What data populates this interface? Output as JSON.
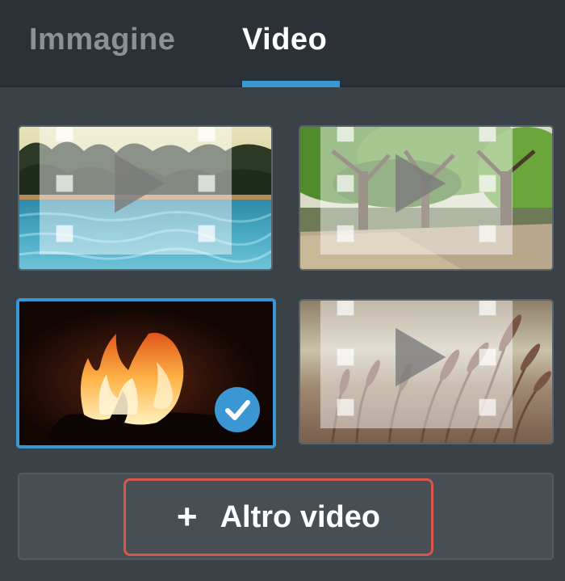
{
  "tabs": [
    {
      "label": "Immagine",
      "active": false
    },
    {
      "label": "Video",
      "active": true
    }
  ],
  "accent_color": "#3b97d3",
  "thumbnails": [
    {
      "subject": "pool water with palm trees",
      "selected": false,
      "icon": "video-play-icon"
    },
    {
      "subject": "tree-lined park path",
      "selected": false,
      "icon": "video-play-icon"
    },
    {
      "subject": "fire flames",
      "selected": true,
      "icon": "checkmark-icon"
    },
    {
      "subject": "wheat grass in field",
      "selected": false,
      "icon": "video-play-icon"
    }
  ],
  "more_button": {
    "icon": "plus-icon",
    "label": "Altro video"
  }
}
